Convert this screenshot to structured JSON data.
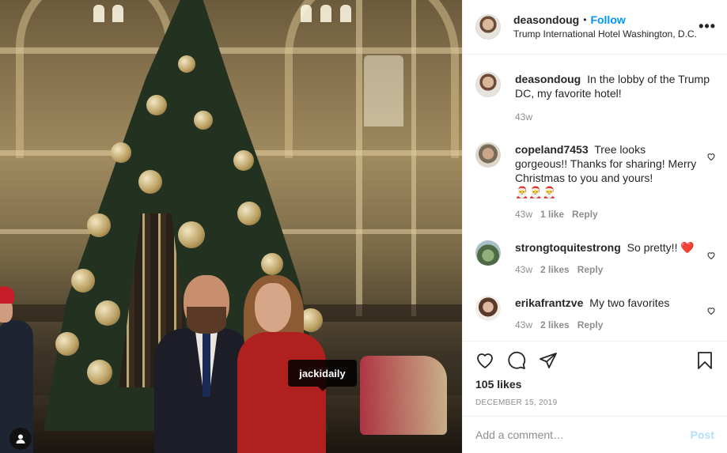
{
  "post": {
    "username": "deasondoug",
    "separator": "•",
    "follow_label": "Follow",
    "location": "Trump International Hotel Washington, D.C.",
    "more_label": "•••",
    "caption": "In the lobby of the Trump DC, my favorite hotel!",
    "caption_age": "43w",
    "photo_tag": "jackidaily",
    "likes": "105 likes",
    "date": "DECEMBER 15, 2019"
  },
  "comments": [
    {
      "username": "copeland7453",
      "text": "Tree looks gorgeous!! Thanks for sharing! Merry Christmas to you and yours!",
      "emoji": "🎅🎅🎅",
      "age": "43w",
      "likes": "1 like",
      "reply_label": "Reply"
    },
    {
      "username": "strongtoquitestrong",
      "text": "So pretty!!",
      "emoji": "❤️",
      "age": "43w",
      "likes": "2 likes",
      "reply_label": "Reply"
    },
    {
      "username": "erikafrantzve",
      "text": "My two favorites",
      "emoji": "",
      "age": "43w",
      "likes": "2 likes",
      "reply_label": "Reply"
    }
  ],
  "add_comment": {
    "placeholder": "Add a comment…",
    "post_label": "Post"
  },
  "colors": {
    "accent": "#0095f6",
    "post_disabled": "#b2dffc",
    "muted": "#8e8e8e",
    "heart": "#ed4956"
  },
  "icons": [
    "more-icon",
    "heart-icon",
    "comment-icon",
    "share-icon",
    "save-icon",
    "tagged-user-icon"
  ]
}
